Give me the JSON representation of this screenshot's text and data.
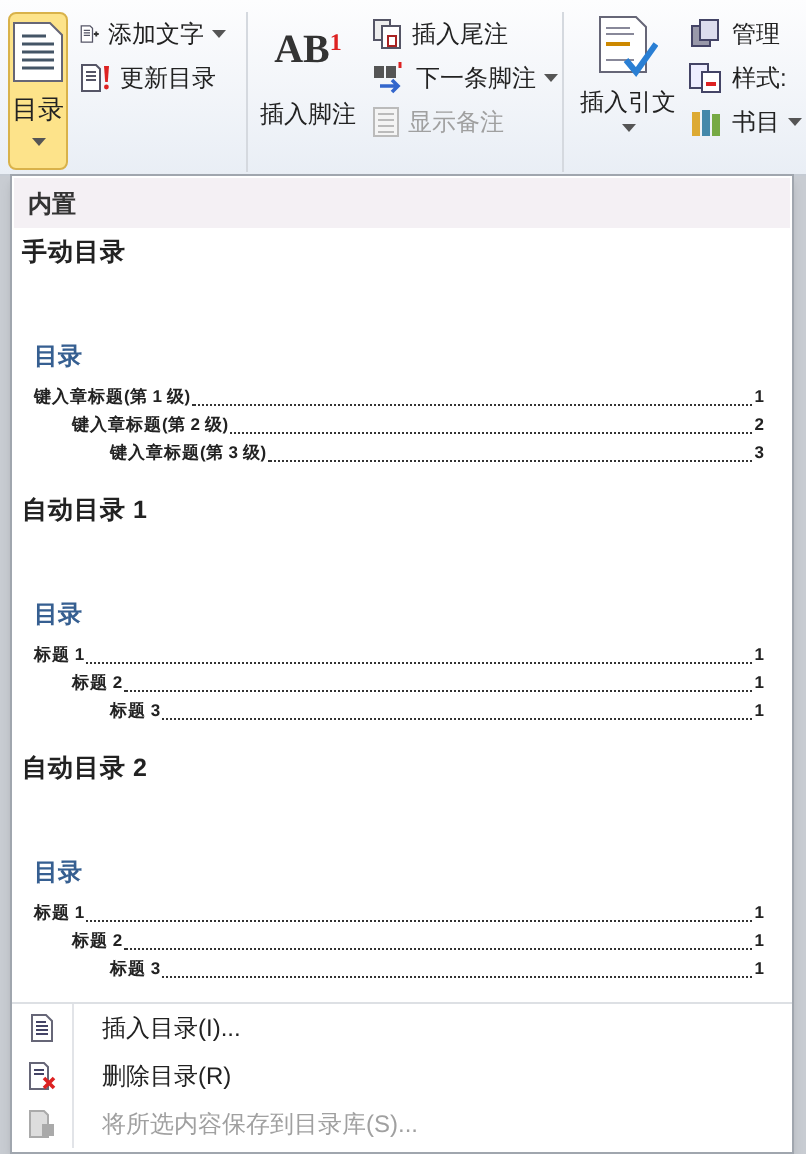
{
  "ribbon": {
    "toc_button": {
      "label": "目录",
      "selected": true
    },
    "groups": [
      {
        "kind": "small-stack",
        "items": [
          {
            "label": "添加文字",
            "dropdown": true,
            "disabled": false
          },
          {
            "label": "更新目录",
            "dropdown": false,
            "disabled": false
          }
        ]
      },
      {
        "kind": "footnote",
        "large": {
          "label": "插入脚注",
          "icon_text": "AB$^{1}$"
        },
        "items": [
          {
            "label": "插入尾注",
            "dropdown": false,
            "disabled": false
          },
          {
            "label": "下一条脚注",
            "dropdown": true,
            "disabled": false
          },
          {
            "label": "显示备注",
            "dropdown": false,
            "disabled": true
          }
        ]
      },
      {
        "kind": "citation",
        "large": {
          "label": "插入引文",
          "dropdown": true
        },
        "items": [
          {
            "label": "管理",
            "dropdown": false,
            "disabled": false
          },
          {
            "label": "样式:",
            "dropdown": false,
            "disabled": false
          },
          {
            "label": "书目",
            "dropdown": true,
            "disabled": false
          }
        ]
      }
    ]
  },
  "menu": {
    "header": "内置",
    "entries": [
      {
        "title": "手动目录",
        "toc_title": "目录",
        "lines": [
          {
            "text": "键入章标题(第 1 级)",
            "page": "1",
            "children": [
              {
                "text": "键入章标题(第 2 级)",
                "page": "2",
                "children": [
                  {
                    "text": "键入章标题(第 3 级)",
                    "page": "3"
                  }
                ]
              }
            ]
          }
        ]
      },
      {
        "title": "自动目录 1",
        "toc_title": "目录",
        "lines": [
          {
            "text": "标题 1",
            "page": "1",
            "children": [
              {
                "text": "标题 2",
                "page": "1",
                "children": [
                  {
                    "text": "标题 3",
                    "page": "1"
                  }
                ]
              }
            ]
          }
        ]
      },
      {
        "title": "自动目录 2",
        "toc_title": "目录",
        "lines": [
          {
            "text": "标题 1",
            "page": "1",
            "children": [
              {
                "text": "标题 2",
                "page": "1",
                "children": [
                  {
                    "text": "标题 3",
                    "page": "1"
                  }
                ]
              }
            ]
          }
        ]
      }
    ],
    "actions": [
      {
        "label": "插入目录(I)...",
        "kind": "insert",
        "disabled": false
      },
      {
        "label": "删除目录(R)",
        "kind": "delete",
        "disabled": false
      },
      {
        "label": "将所选内容保存到目录库(S)...",
        "kind": "save",
        "disabled": true
      }
    ]
  }
}
